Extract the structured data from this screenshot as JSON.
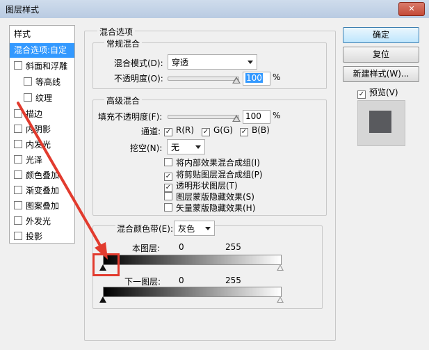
{
  "window": {
    "title": "图层样式",
    "close_label": "✕"
  },
  "styles_list": {
    "header": "样式",
    "items": [
      {
        "label": "混合选项:自定",
        "checkbox": false,
        "selected": true
      },
      {
        "label": "斜面和浮雕",
        "checkbox": true,
        "checked": false
      },
      {
        "label": "等高线",
        "checkbox": true,
        "checked": false
      },
      {
        "label": "纹理",
        "checkbox": true,
        "checked": false
      },
      {
        "label": "描边",
        "checkbox": true,
        "checked": false
      },
      {
        "label": "内阴影",
        "checkbox": true,
        "checked": false
      },
      {
        "label": "内发光",
        "checkbox": true,
        "checked": false
      },
      {
        "label": "光泽",
        "checkbox": true,
        "checked": false
      },
      {
        "label": "颜色叠加",
        "checkbox": true,
        "checked": false
      },
      {
        "label": "渐变叠加",
        "checkbox": true,
        "checked": false
      },
      {
        "label": "图案叠加",
        "checkbox": true,
        "checked": false
      },
      {
        "label": "外发光",
        "checkbox": true,
        "checked": false
      },
      {
        "label": "投影",
        "checkbox": true,
        "checked": false
      }
    ]
  },
  "blend_options": {
    "title": "混合选项",
    "general": {
      "title": "常规混合",
      "mode_label": "混合模式(D):",
      "mode_value": "穿透",
      "opacity_label": "不透明度(O):",
      "opacity_value": "100",
      "percent": "%"
    },
    "advanced": {
      "title": "高级混合",
      "fill_label": "填充不透明度(F):",
      "fill_value": "100",
      "percent": "%",
      "channels_label": "通道:",
      "channel_r": "R(R)",
      "channel_g": "G(G)",
      "channel_b": "B(B)",
      "knockout_label": "挖空(N):",
      "knockout_value": "无",
      "options": [
        {
          "label": "将内部效果混合成组(I)",
          "checked": false
        },
        {
          "label": "将剪贴图层混合成组(P)",
          "checked": true
        },
        {
          "label": "透明形状图层(T)",
          "checked": true
        },
        {
          "label": "图层蒙版隐藏效果(S)",
          "checked": false
        },
        {
          "label": "矢量蒙版隐藏效果(H)",
          "checked": false
        }
      ]
    },
    "blend_if": {
      "label": "混合颜色带(E):",
      "value": "灰色",
      "this_layer_label": "本图层:",
      "this_layer_low": "0",
      "this_layer_high": "255",
      "underlying_label": "下一图层:",
      "underlying_low": "0",
      "underlying_high": "255"
    }
  },
  "buttons": {
    "ok": "确定",
    "reset": "复位",
    "new_style": "新建样式(W)...",
    "preview_label": "预览(V)"
  },
  "colors": {
    "selection": "#3399ff",
    "annotation": "#e23b2e"
  }
}
